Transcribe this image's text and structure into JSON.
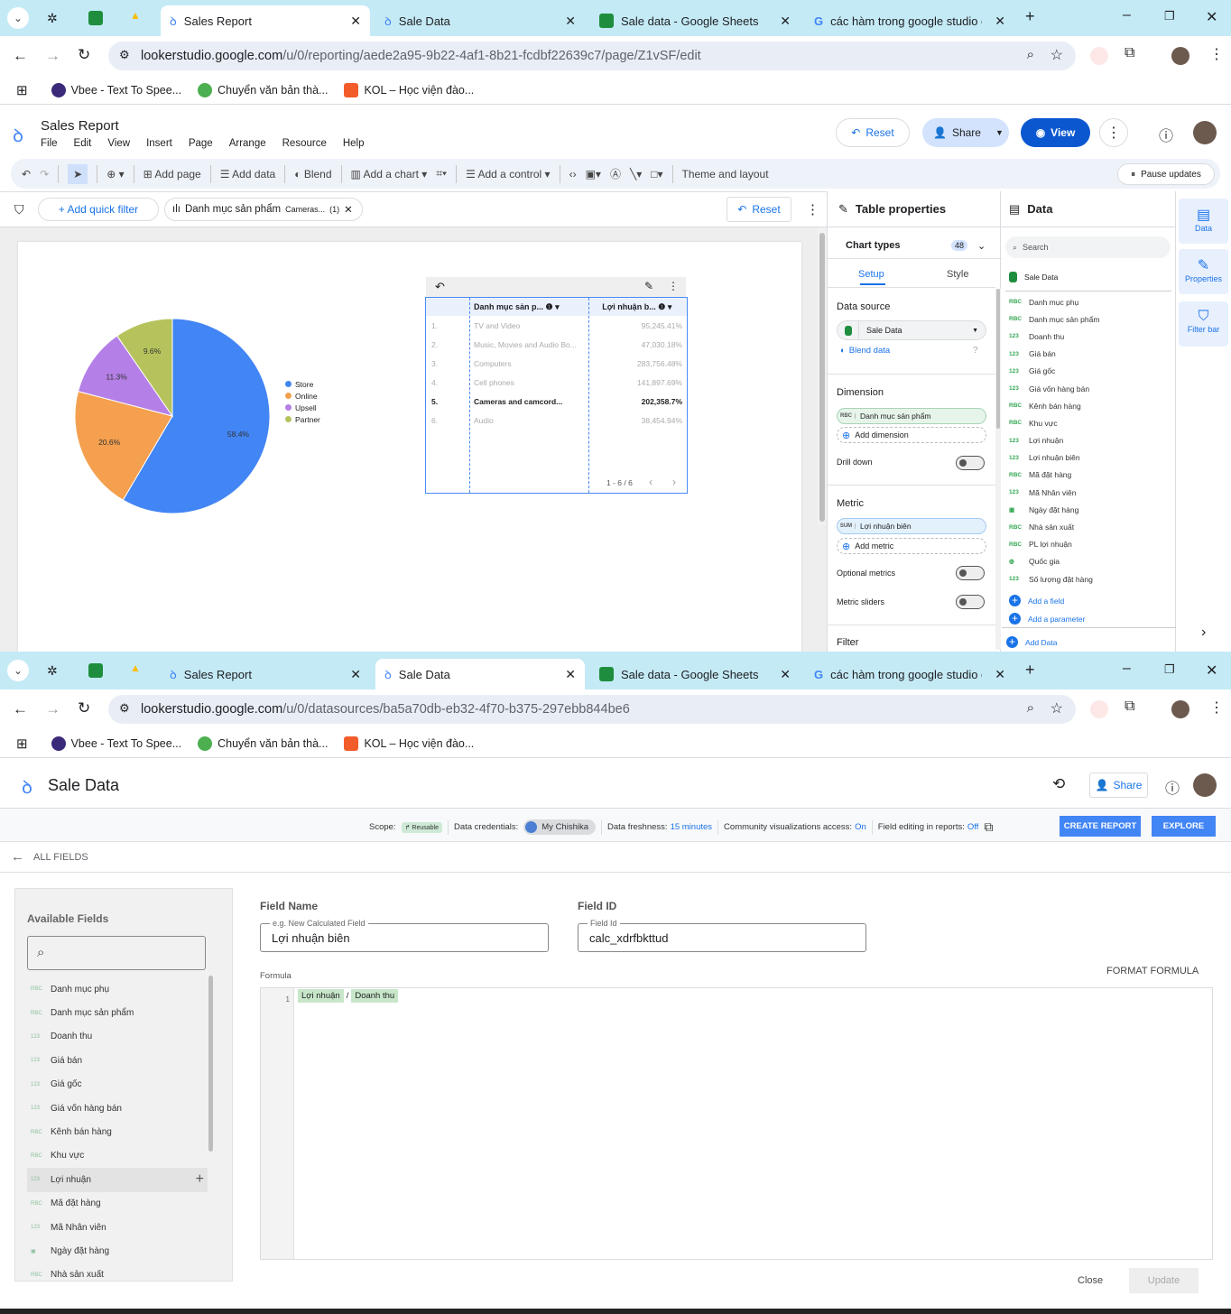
{
  "browser_tabs_top": [
    {
      "label": "Sales Report",
      "active": true
    },
    {
      "label": "Sale Data"
    },
    {
      "label": "Sale data - Google Sheets"
    },
    {
      "label": "các hàm trong google studio ca"
    }
  ],
  "browser_tabs_bottom": [
    {
      "label": "Sales Report"
    },
    {
      "label": "Sale Data",
      "active": true
    },
    {
      "label": "Sale data - Google Sheets"
    },
    {
      "label": "các hàm trong google studio ca"
    }
  ],
  "url_top": {
    "host": "lookerstudio.google.com",
    "path": "/u/0/reporting/aede2a95-9b22-4af1-8b21-fcdbf22639c7/page/Z1vSF/edit"
  },
  "url_bottom": {
    "host": "lookerstudio.google.com",
    "path": "/u/0/datasources/ba5a70db-eb32-4f70-b375-297ebb844be6"
  },
  "bookmarks": [
    "Vbee - Text To Spee...",
    "Chuyển văn bản thà...",
    "KOL – Học viện đào..."
  ],
  "report": {
    "title": "Sales Report",
    "menu": [
      "File",
      "Edit",
      "View",
      "Insert",
      "Page",
      "Arrange",
      "Resource",
      "Help"
    ],
    "reset": "Reset",
    "share": "Share",
    "view": "View",
    "toolbar": {
      "add_page": "Add page",
      "add_data": "Add data",
      "blend": "Blend",
      "add_chart": "Add a chart",
      "add_control": "Add a control",
      "theme": "Theme and layout",
      "pause": "Pause updates"
    },
    "filterbar": {
      "add_quick_filter": "+ Add quick filter",
      "chip_label": "Danh mục sản phẩm",
      "chip_value": "Cameras...",
      "chip_count": "(1)",
      "reset": "Reset"
    }
  },
  "chart_data": [
    {
      "type": "pie",
      "labels": [
        "Store",
        "Online",
        "Upsell",
        "Partner"
      ],
      "values": [
        58.4,
        20.6,
        11.3,
        9.6
      ],
      "value_labels": [
        "58.4%",
        "20.6%",
        "11.3%",
        "9.6%"
      ],
      "colors": [
        "#4285f4",
        "#f4a04e",
        "#b47fe6",
        "#b6c35c"
      ],
      "legend_position": "right"
    },
    {
      "type": "table",
      "columns": [
        "Danh mục sản p...",
        "Lợi nhuận b..."
      ],
      "rows": [
        [
          "1.",
          "TV and Video",
          "95,245.41%"
        ],
        [
          "2.",
          "Music, Movies and Audio Bo...",
          "47,030.18%"
        ],
        [
          "3.",
          "Computers",
          "283,756.48%"
        ],
        [
          "4.",
          "Cell phones",
          "141,897.69%"
        ],
        [
          "5.",
          "Cameras and camcord...",
          "202,358.7%"
        ],
        [
          "6.",
          "Audio",
          "38,454.94%"
        ]
      ],
      "highlighted_row": 4,
      "pagination": "1 - 6 / 6"
    }
  ],
  "properties": {
    "title": "Table properties",
    "chart_types": "Chart types",
    "chart_types_count": "48",
    "tabs": [
      "Setup",
      "Style"
    ],
    "data_source_label": "Data source",
    "data_source": "Sale Data",
    "blend_data": "Blend data",
    "dimension_label": "Dimension",
    "dimension_type": "RBC",
    "dimension": "Danh mục sản phẩm",
    "add_dimension": "Add dimension",
    "drill_down": "Drill down",
    "metric_label": "Metric",
    "metric_agg": "SUM",
    "metric": "Lợi nhuận biên",
    "add_metric": "Add metric",
    "optional_metrics": "Optional metrics",
    "metric_sliders": "Metric sliders",
    "filter_label": "Filter"
  },
  "data_panel": {
    "title": "Data",
    "search_placeholder": "Search",
    "source": "Sale Data",
    "fields": [
      [
        "RBC",
        "Danh mục phụ"
      ],
      [
        "RBC",
        "Danh mục sản phẩm"
      ],
      [
        "123",
        "Doanh thu"
      ],
      [
        "123",
        "Giá bán"
      ],
      [
        "123",
        "Giá gốc"
      ],
      [
        "123",
        "Giá vốn hàng bán"
      ],
      [
        "RBC",
        "Kênh bán hàng"
      ],
      [
        "RBC",
        "Khu vực"
      ],
      [
        "123",
        "Lợi nhuận"
      ],
      [
        "123",
        "Lợi nhuận biên"
      ],
      [
        "RBC",
        "Mã đặt hàng"
      ],
      [
        "123",
        "Mã Nhân viên"
      ],
      [
        "DATE",
        "Ngày đặt hàng"
      ],
      [
        "RBC",
        "Nhà sản xuất"
      ],
      [
        "RBC",
        "PL lợi nhuận"
      ],
      [
        "GEO",
        "Quốc gia"
      ],
      [
        "123",
        "Số lượng đặt hàng"
      ]
    ],
    "add_field": "Add a field",
    "add_parameter": "Add a parameter",
    "add_data": "Add Data"
  },
  "rail": [
    "Data",
    "Properties",
    "Filter bar"
  ],
  "datasource": {
    "title": "Sale Data",
    "share": "Share",
    "scope_label": "Scope:",
    "scope": "Reusable",
    "cred_label": "Data credentials:",
    "cred": "My Chishika",
    "fresh_label": "Data freshness:",
    "fresh": "15 minutes",
    "comm_label": "Community visualizations access:",
    "comm": "On",
    "edit_label": "Field editing in reports:",
    "edit": "Off",
    "create_report": "CREATE REPORT",
    "explore": "EXPLORE",
    "all_fields": "ALL FIELDS",
    "available_fields": "Available Fields",
    "fields": [
      [
        "RBC",
        "Danh mục phụ"
      ],
      [
        "RBC",
        "Danh mục sản phẩm"
      ],
      [
        "123",
        "Doanh thu"
      ],
      [
        "123",
        "Giá bán"
      ],
      [
        "123",
        "Giá gốc"
      ],
      [
        "123",
        "Giá vốn hàng bán"
      ],
      [
        "RBC",
        "Kênh bán hàng"
      ],
      [
        "RBC",
        "Khu vực"
      ],
      [
        "123",
        "Lợi nhuận"
      ],
      [
        "RBC",
        "Mã đặt hàng"
      ],
      [
        "123",
        "Mã Nhân viên"
      ],
      [
        "DATE",
        "Ngày đặt hàng"
      ],
      [
        "RBC",
        "Nhà sản xuất"
      ]
    ],
    "field_name_label": "Field Name",
    "field_name_placeholder": "e.g. New Calculated Field",
    "field_name": "Lợi nhuận biên",
    "field_id_label": "Field ID",
    "field_id_placeholder": "Field Id",
    "field_id": "calc_xdrfbkttud",
    "formula_label": "Formula",
    "format_formula": "FORMAT FORMULA",
    "formula_line": "1",
    "formula_tokens": [
      "Lợi nhuận",
      "/",
      "Doanh thu"
    ],
    "close": "Close",
    "update": "Update"
  }
}
